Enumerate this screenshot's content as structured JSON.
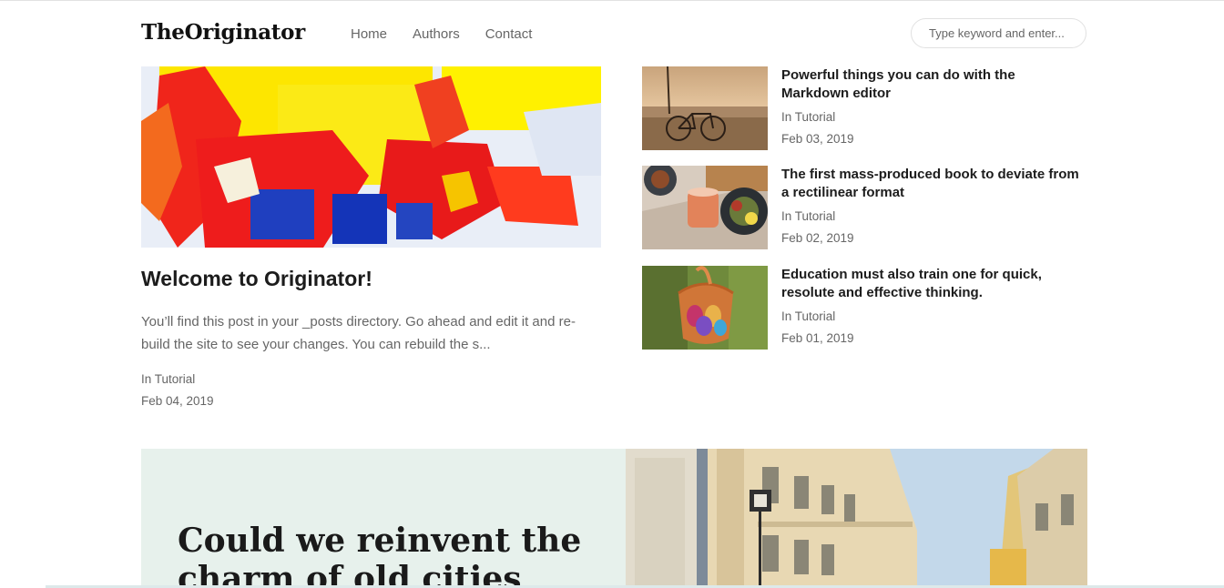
{
  "header": {
    "logo": "TheOriginator",
    "nav": [
      "Home",
      "Authors",
      "Contact"
    ],
    "search_placeholder": "Type keyword and enter..."
  },
  "featured": {
    "title": "Welcome to Originator!",
    "excerpt": "You’ll find this post in your _posts directory. Go ahead and edit it and re-build the site to see your changes. You can rebuild the s...",
    "category": "In Tutorial",
    "date": "Feb 04, 2019"
  },
  "side_posts": [
    {
      "title": "Powerful things you can do with the Markdown editor",
      "category": "In Tutorial",
      "date": "Feb 03, 2019"
    },
    {
      "title": "The first mass-produced book to deviate from a rectilinear format",
      "category": "In Tutorial",
      "date": "Feb 02, 2019"
    },
    {
      "title": "Education must also train one for quick, resolute and effective thinking.",
      "category": "In Tutorial",
      "date": "Feb 01, 2019"
    }
  ],
  "hero": {
    "title": "Could we reinvent the charm of old cities"
  }
}
